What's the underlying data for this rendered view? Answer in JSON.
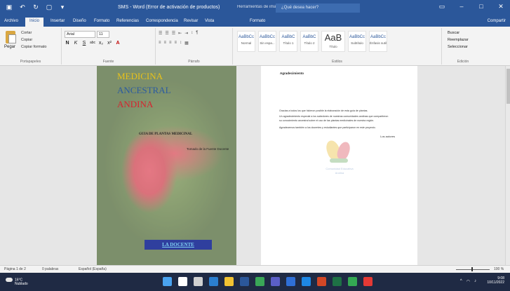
{
  "titlebar": {
    "quick_access": [
      "▣",
      "↶",
      "↻",
      "▢",
      "▾"
    ],
    "doc_title": "SMS - Word (Error de activación de productos)",
    "context_title": "Herramientas de imagen",
    "search_placeholder": "¿Qué desea hacer?",
    "window_controls": [
      "▭",
      "–",
      "□",
      "✕"
    ]
  },
  "tabs": [
    {
      "label": "Archivo",
      "active": false
    },
    {
      "label": "Inicio",
      "active": true
    },
    {
      "label": "Insertar",
      "active": false
    },
    {
      "label": "Diseño",
      "active": false
    },
    {
      "label": "Formato",
      "active": false
    },
    {
      "label": "Referencias",
      "active": false
    },
    {
      "label": "Correspondencia",
      "active": false
    },
    {
      "label": "Revisar",
      "active": false
    },
    {
      "label": "Vista",
      "active": false
    },
    {
      "label": "Formato",
      "active": false
    }
  ],
  "share_label": "Compartir",
  "ribbon": {
    "clipboard": {
      "paste": "Pegar",
      "items": [
        "Cortar",
        "Copiar",
        "Copiar formato"
      ],
      "label": "Portapapeles"
    },
    "font": {
      "name": "Arial",
      "size": "11",
      "buttons": [
        "N",
        "K",
        "S",
        "abc",
        "x₂",
        "x²",
        "A"
      ],
      "label": "Fuente"
    },
    "paragraph": {
      "row1": [
        "☰",
        "☰",
        "☰",
        "⇤",
        "⇥",
        "↕",
        "¶"
      ],
      "row2": [
        "≡",
        "≡",
        "≡",
        "≡",
        "↕",
        "▦"
      ],
      "label": "Párrafo"
    },
    "styles": {
      "items": [
        {
          "sample": "AaBbCc",
          "name": "Normal"
        },
        {
          "sample": "AaBbCc",
          "name": "Sin espa..."
        },
        {
          "sample": "AaBbC",
          "name": "Título 1"
        },
        {
          "sample": "AaBbC",
          "name": "Título 2"
        },
        {
          "sample": "AaB",
          "name": "Título"
        },
        {
          "sample": "AaBbCc",
          "name": "Subtítulo"
        },
        {
          "sample": "AaBbCc",
          "name": "Énfasis sutil"
        }
      ],
      "label": "Estilos"
    },
    "editing": {
      "items": [
        "Buscar",
        "Reemplazar",
        "Seleccionar"
      ],
      "label": "Edición"
    }
  },
  "cover": {
    "title1": "MEDICINA",
    "title2": "ANCESTRAL",
    "title3": "ANDINA",
    "subtitle": "GUIA DE PLANTAS MEDICINAL",
    "author": "Tomado de la Fuente Docente",
    "logo_text": "LA DOCENTE"
  },
  "right_page": {
    "heading": "Agradecimiento",
    "lines": [
      "Gracias a todos los que hicieron posible la elaboración de esta guía de plantas.",
      "Un agradecimiento especial a los sabedores de nuestras comunidades andinas que compartieron",
      "su conocimiento ancestral sobre el uso de las plantas medicinales de nuestra región.",
      "Agradecemos también a los docentes y estudiantes que participaron en este proyecto."
    ],
    "signature": "Los autores",
    "watermark_line1": "Comunidad Educativa",
    "watermark_line2": "Andina"
  },
  "statusbar": {
    "page": "Página 1 de 2",
    "words": "0 palabras",
    "language": "Español (España)",
    "zoom": "100 %"
  },
  "taskbar": {
    "weather_temp": "16°C",
    "weather_desc": "Nublado",
    "time": "9:08",
    "date": "10/11/2022",
    "apps": [
      {
        "name": "windows-start",
        "color": "#4aa3f0"
      },
      {
        "name": "search",
        "color": "#ffffff"
      },
      {
        "name": "task-view",
        "color": "#d0d0d0"
      },
      {
        "name": "edge",
        "color": "#2b7fd0"
      },
      {
        "name": "file-explorer",
        "color": "#f1c232"
      },
      {
        "name": "word",
        "color": "#2b579a"
      },
      {
        "name": "chrome",
        "color": "#3aa757"
      },
      {
        "name": "teams",
        "color": "#5b5fc7"
      },
      {
        "name": "store",
        "color": "#2f6fd6"
      },
      {
        "name": "mail",
        "color": "#1e88e5"
      },
      {
        "name": "powerpoint",
        "color": "#d24726"
      },
      {
        "name": "excel",
        "color": "#1e7145"
      },
      {
        "name": "app-green",
        "color": "#34a853"
      },
      {
        "name": "app-red",
        "color": "#e53935"
      }
    ]
  }
}
